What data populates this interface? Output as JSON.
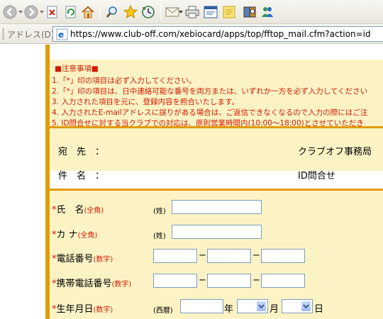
{
  "browser": {
    "toolbar_icons": [
      "back-icon",
      "forward-icon",
      "stop-icon",
      "refresh-icon",
      "home-icon",
      "search-icon",
      "favorites-icon",
      "history-icon",
      "mail-icon",
      "print-icon",
      "edit-icon",
      "discuss-icon",
      "research-icon",
      "messenger-icon"
    ],
    "address_label": "アドレス(D)",
    "url": "https://www.club-off.com/xebiocard/apps/top/fftop_mail.cfm?action=id"
  },
  "notes": {
    "title": "■注意事項■",
    "lines": [
      "1.「*」印の項目は必ず入力してください。",
      "2.「*」印の項目は、日中連絡可能な番号を両方または、いずれか一方を必ず入力してください",
      "3. 入力された項目を元に、登録内容を照合いたします。",
      "4. 入力されたE-mailアドレスに誤りがある場合は、ご返信できなくなるので入力の際にはご注",
      "5. ID問合せに対する当クラブでの対応は、原則営業時間内(10:00〜18:00)とさせていただき"
    ]
  },
  "message_info": {
    "to_label": "宛　先　：",
    "to_value": "クラブオフ事務局",
    "subject_label": "件　名　：",
    "subject_value": "ID問合せ"
  },
  "form": {
    "required_mark": "*",
    "name": {
      "label": "氏　名",
      "hint": "(全角)",
      "sublabel": "(姓)",
      "value": ""
    },
    "kana": {
      "label": "カ ナ",
      "hint": "(全角)",
      "sublabel": "(姓)",
      "value": ""
    },
    "phone": {
      "label": "電話番号",
      "hint": "(数字)",
      "separator": "−",
      "parts": [
        "",
        "",
        ""
      ]
    },
    "mobile": {
      "label": "携帯電話番号",
      "hint": "(数字)",
      "separator": "−",
      "parts": [
        "",
        "",
        ""
      ]
    },
    "birthdate": {
      "label": "生年月日",
      "hint": "(数字)",
      "era_label": "(西暦)",
      "year_value": "",
      "year_unit": "年",
      "month_value": "",
      "month_unit": "月",
      "day_value": "",
      "day_unit": "日"
    }
  },
  "colors": {
    "accent_orange": "#e29b09",
    "panel_yellow": "#fcf3c5",
    "notice_red": "#d21a00",
    "input_border": "#7f9db9"
  }
}
